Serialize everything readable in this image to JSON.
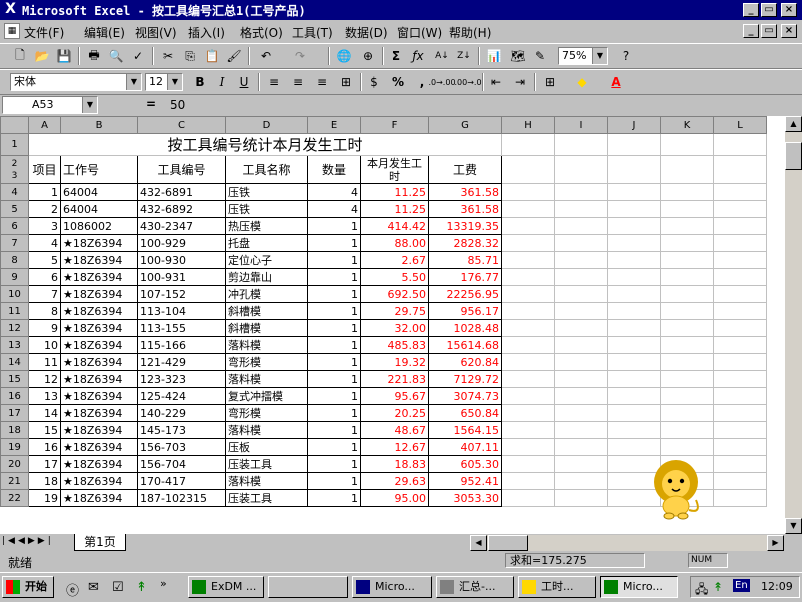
{
  "window": {
    "title": "Microsoft Excel - 按工具编号汇总1(工号产品)"
  },
  "menu": [
    "文件(F)",
    "编辑(E)",
    "视图(V)",
    "插入(I)",
    "格式(O)",
    "工具(T)",
    "数据(D)",
    "窗口(W)",
    "帮助(H)"
  ],
  "toolbar": {
    "zoom": "75%",
    "font": "宋体",
    "size": "12"
  },
  "formula_bar": {
    "cell_ref": "A53",
    "equals": "=",
    "value": "50"
  },
  "columns": [
    "A",
    "B",
    "C",
    "D",
    "E",
    "F",
    "G",
    "H",
    "I",
    "J",
    "K",
    "L"
  ],
  "sheet_title": "按工具编号统计本月发生工时",
  "headers": {
    "item": "项目",
    "job_no": "工作号",
    "tool_no": "工具编号",
    "tool_name": "工具名称",
    "qty": "数量",
    "hours": "本月发生工时",
    "cost": "工费"
  },
  "header_row_nums": [
    "2",
    "3"
  ],
  "rows": [
    {
      "r": "4",
      "item": "1",
      "job": "64004",
      "tool": "432-6891",
      "name": "压铁",
      "qty": "4",
      "hours": "11.25",
      "cost": "361.58"
    },
    {
      "r": "5",
      "item": "2",
      "job": "64004",
      "tool": "432-6892",
      "name": "压铁",
      "qty": "4",
      "hours": "11.25",
      "cost": "361.58"
    },
    {
      "r": "6",
      "item": "3",
      "job": "1086002",
      "tool": "430-2347",
      "name": "热压模",
      "qty": "1",
      "hours": "414.42",
      "cost": "13319.35"
    },
    {
      "r": "7",
      "item": "4",
      "job": "★18Z6394",
      "tool": "100-929",
      "name": "托盘",
      "qty": "1",
      "hours": "88.00",
      "cost": "2828.32"
    },
    {
      "r": "8",
      "item": "5",
      "job": "★18Z6394",
      "tool": "100-930",
      "name": "定位心子",
      "qty": "1",
      "hours": "2.67",
      "cost": "85.71"
    },
    {
      "r": "9",
      "item": "6",
      "job": "★18Z6394",
      "tool": "100-931",
      "name": "剪边靠山",
      "qty": "1",
      "hours": "5.50",
      "cost": "176.77"
    },
    {
      "r": "10",
      "item": "7",
      "job": "★18Z6394",
      "tool": "107-152",
      "name": "冲孔模",
      "qty": "1",
      "hours": "692.50",
      "cost": "22256.95"
    },
    {
      "r": "11",
      "item": "8",
      "job": "★18Z6394",
      "tool": "113-104",
      "name": "斜槽模",
      "qty": "1",
      "hours": "29.75",
      "cost": "956.17"
    },
    {
      "r": "12",
      "item": "9",
      "job": "★18Z6394",
      "tool": "113-155",
      "name": "斜槽模",
      "qty": "1",
      "hours": "32.00",
      "cost": "1028.48"
    },
    {
      "r": "13",
      "item": "10",
      "job": "★18Z6394",
      "tool": "115-166",
      "name": "落料模",
      "qty": "1",
      "hours": "485.83",
      "cost": "15614.68"
    },
    {
      "r": "14",
      "item": "11",
      "job": "★18Z6394",
      "tool": "121-429",
      "name": "弯形模",
      "qty": "1",
      "hours": "19.32",
      "cost": "620.84"
    },
    {
      "r": "15",
      "item": "12",
      "job": "★18Z6394",
      "tool": "123-323",
      "name": "落料模",
      "qty": "1",
      "hours": "221.83",
      "cost": "7129.72"
    },
    {
      "r": "16",
      "item": "13",
      "job": "★18Z6394",
      "tool": "125-424",
      "name": "复式冲擂模",
      "qty": "1",
      "hours": "95.67",
      "cost": "3074.73"
    },
    {
      "r": "17",
      "item": "14",
      "job": "★18Z6394",
      "tool": "140-229",
      "name": "弯形模",
      "qty": "1",
      "hours": "20.25",
      "cost": "650.84"
    },
    {
      "r": "18",
      "item": "15",
      "job": "★18Z6394",
      "tool": "145-173",
      "name": "落料模",
      "qty": "1",
      "hours": "48.67",
      "cost": "1564.15"
    },
    {
      "r": "19",
      "item": "16",
      "job": "★18Z6394",
      "tool": "156-703",
      "name": "压板",
      "qty": "1",
      "hours": "12.67",
      "cost": "407.11"
    },
    {
      "r": "20",
      "item": "17",
      "job": "★18Z6394",
      "tool": "156-704",
      "name": "压装工具",
      "qty": "1",
      "hours": "18.83",
      "cost": "605.30"
    },
    {
      "r": "21",
      "item": "18",
      "job": "★18Z6394",
      "tool": "170-417",
      "name": "落料模",
      "qty": "1",
      "hours": "29.63",
      "cost": "952.41"
    },
    {
      "r": "22",
      "item": "19",
      "job": "★18Z6394",
      "tool": "187-102315",
      "name": "压装工具",
      "qty": "1",
      "hours": "95.00",
      "cost": "3053.30"
    }
  ],
  "sheet_tab": "第1页",
  "status": {
    "ready": "就绪",
    "sum": "求和=175.275",
    "num": "NUM"
  },
  "taskbar": {
    "start": "开始",
    "buttons": [
      "ExDM ...",
      "",
      "Micro...",
      "汇总-...",
      "工时...",
      "Micro..."
    ],
    "ime": "En",
    "clock": "12:09"
  },
  "colors": {
    "title_bg": "#000080",
    "red_values": "#ff0000",
    "chrome": "#c0c0c0"
  }
}
